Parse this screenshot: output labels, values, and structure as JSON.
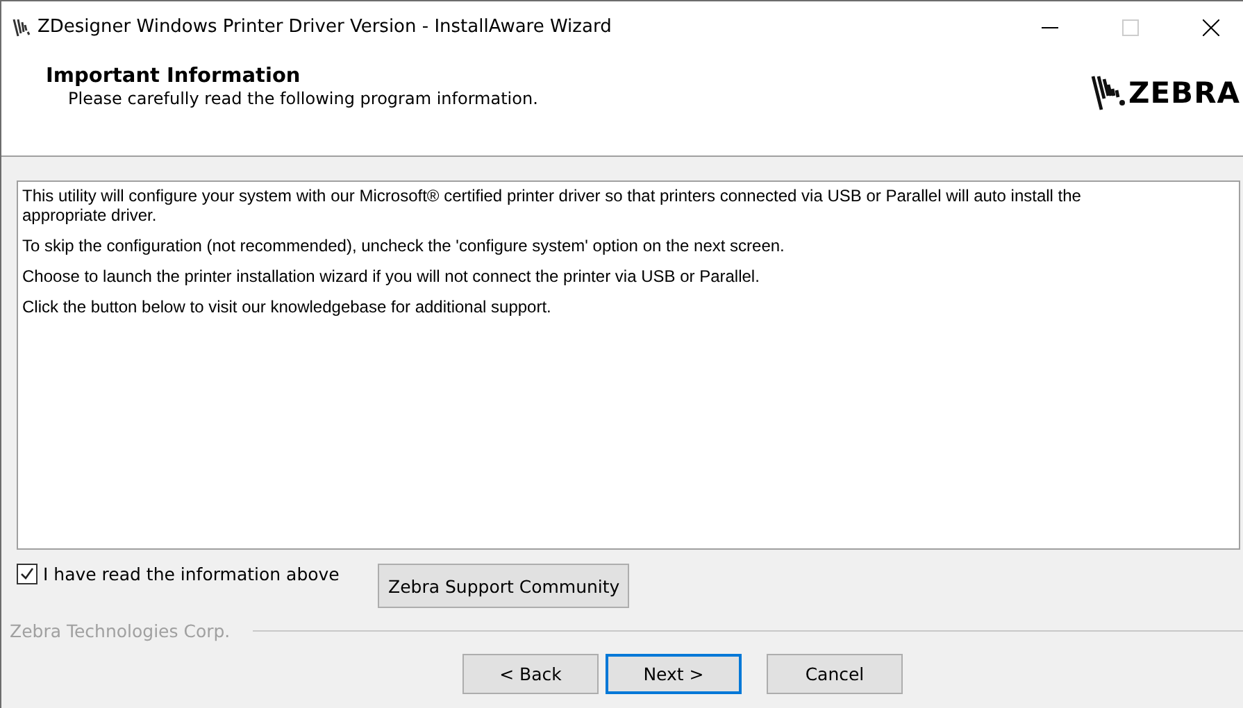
{
  "window": {
    "title": "ZDesigner Windows Printer Driver Version - InstallAware Wizard"
  },
  "header": {
    "title": "Important Information",
    "subtitle": "Please carefully read the following program information.",
    "logo": "ZEBRA"
  },
  "info_text": [
    "This utility will configure your system with our Microsoft® certified printer driver so that printers connected via USB or Parallel will auto install the appropriate driver.",
    "To skip the configuration (not recommended), uncheck the 'configure system' option on the next screen.",
    "Choose to launch the printer installation wizard if you will not connect the printer via USB or Parallel.",
    "Click the button below to visit our knowledgebase for additional support."
  ],
  "agree_checkbox": {
    "label": "I have read the information above",
    "checked": true
  },
  "support_button": "Zebra Support Community",
  "brand": "Zebra Technologies Corp.",
  "buttons": [
    {
      "label": "< Back",
      "default": false
    },
    {
      "label": "Next >",
      "default": true
    },
    {
      "label": "Cancel",
      "default": false
    }
  ]
}
